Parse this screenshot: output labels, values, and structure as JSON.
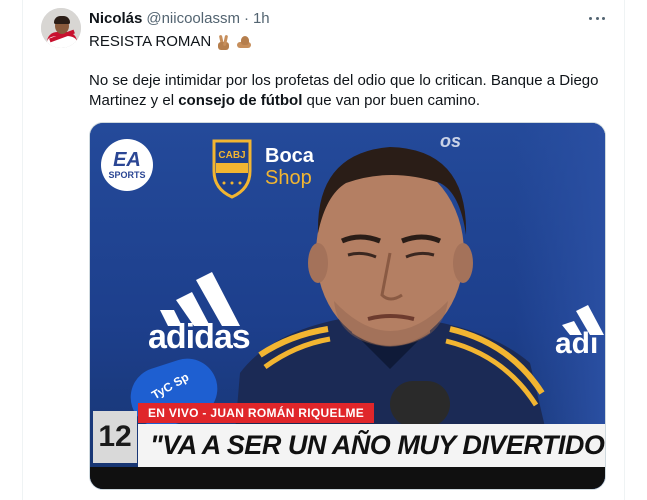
{
  "tweet": {
    "author_name": "Nicolás",
    "author_handle": "@niicoolassm",
    "separator": "·",
    "timestamp": "1h",
    "first_line": "RESISTA ROMAN",
    "emojis": [
      "victory-hand",
      "flexed-biceps"
    ],
    "body_before": "No se deje intimidar por los profetas del odio que lo critican. Banque a Diego Martinez y el ",
    "body_bold": "consejo de fútbol",
    "body_after": " que van por buen camino."
  },
  "media": {
    "sponsor_ea_big": "EA",
    "sponsor_ea_small": "SPORTS",
    "crest_label": "CABJ",
    "boca_label": "Boca",
    "shop_label": "Shop",
    "partial_logo": "os",
    "adidas_label": "adidas",
    "adidas_right_label": "adi",
    "mic_label": "TyC Sp",
    "lower_third": {
      "channel_number": "12",
      "live_label": "EN VIVO - JUAN ROMÁN RIQUELME",
      "quote": "\"VA A SER UN AÑO MUY DIVERTIDO\""
    }
  },
  "colors": {
    "text_primary": "#0f1419",
    "text_secondary": "#536471",
    "divider": "#eff3f4",
    "boca_blue": "#1d3f8c",
    "boca_gold": "#f2b531",
    "live_red": "#e0262a"
  }
}
